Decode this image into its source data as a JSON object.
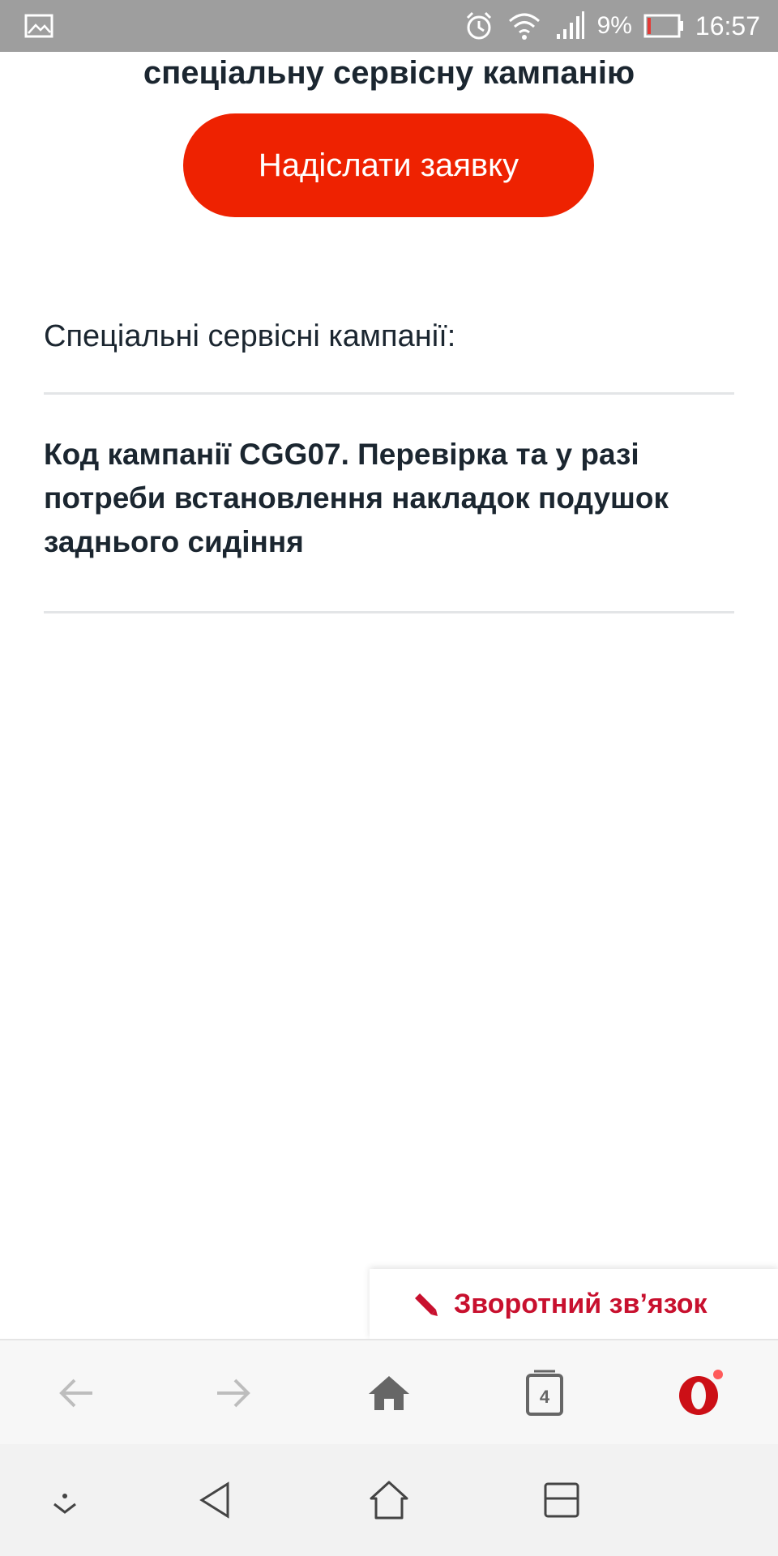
{
  "status_bar": {
    "battery_percent": "9%",
    "time": "16:57",
    "icons": [
      "image-icon",
      "alarm-icon",
      "wifi-icon",
      "signal-icon",
      "battery-icon"
    ]
  },
  "page": {
    "heading_fragment": "спеціальну сервісну кампанію",
    "submit_button_label": "Надіслати заявку",
    "section_label": "Спеціальні сервісні кампанії:",
    "campaign_title": "Код кампанії  CGG07.  Перевірка та у разі потреби встановлення накладок подушок заднього сидіння"
  },
  "feedback": {
    "label": "Зворотний зв’язок",
    "icon": "pencil-icon"
  },
  "browser_toolbar": {
    "tab_count": "4",
    "icons": [
      "back-arrow-icon",
      "forward-arrow-icon",
      "home-icon",
      "tabs-icon",
      "opera-menu-icon"
    ]
  },
  "system_nav": {
    "icons": [
      "hide-keyboard-icon",
      "back-triangle-icon",
      "home-outline-icon",
      "recents-icon"
    ]
  },
  "colors": {
    "accent_red": "#ee2201",
    "feedback_red": "#c8102e",
    "text_dark": "#1b2630",
    "statusbar_gray": "#9e9e9e"
  }
}
